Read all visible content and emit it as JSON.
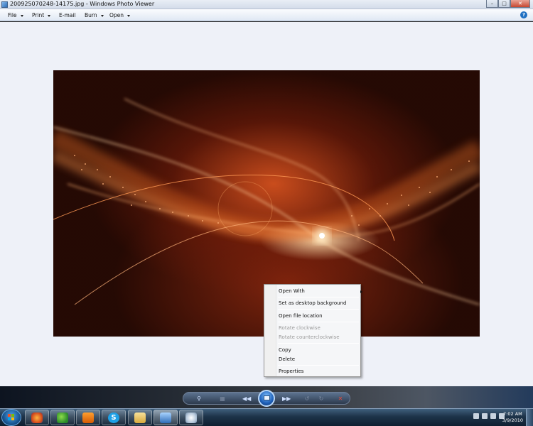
{
  "window": {
    "title": "2009250702​48-14175.jpg - Windows Photo Viewer",
    "minimize_icon": "minimize-icon",
    "maximize_icon": "maximize-icon",
    "close_icon": "close-icon"
  },
  "menubar": {
    "items": [
      {
        "label": "File"
      },
      {
        "label": "Print"
      },
      {
        "label": "E-mail"
      },
      {
        "label": "Burn"
      },
      {
        "label": "Open"
      }
    ],
    "help_label": "?"
  },
  "context_menu": {
    "items": [
      {
        "label": "Open With",
        "submenu": true,
        "enabled": true
      },
      {
        "label": "Set as desktop background",
        "enabled": true
      },
      {
        "label": "Open file location",
        "enabled": true
      },
      {
        "label": "Rotate clockwise",
        "enabled": false
      },
      {
        "label": "Rotate counterclockwise",
        "enabled": false
      },
      {
        "label": "Copy",
        "enabled": true
      },
      {
        "label": "Delete",
        "enabled": true
      },
      {
        "label": "Properties",
        "enabled": true
      }
    ]
  },
  "controls": {
    "zoom_icon": "magnifier-icon",
    "actual_size_icon": "actual-size-icon",
    "previous_icon": "previous-icon",
    "slideshow_icon": "slideshow-icon",
    "next_icon": "next-icon",
    "rotate_ccw_icon": "rotate-counterclockwise-icon",
    "rotate_cw_icon": "rotate-clockwise-icon",
    "delete_icon": "delete-icon"
  },
  "taskbar": {
    "apps": [
      "firefox-icon",
      "messenger-icon",
      "media-player-icon",
      "skype-icon",
      "explorer-icon",
      "photo-viewer-icon",
      "paint-icon"
    ],
    "clock_time": "7:02 AM",
    "clock_date": "3/9/2010"
  },
  "colors": {
    "accent": "#1e6fc2",
    "viewer_bg": "#eef1f8",
    "delete_red": "#e24a3b"
  }
}
